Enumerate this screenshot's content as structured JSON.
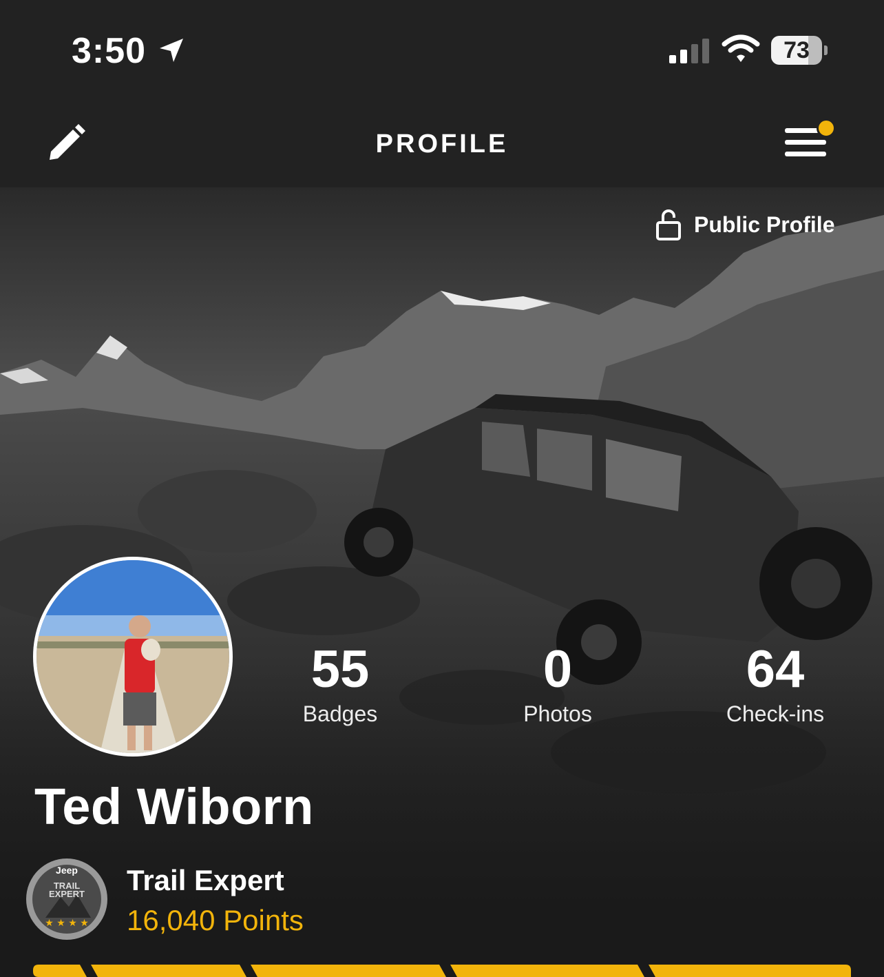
{
  "status_bar": {
    "time": "3:50",
    "battery_percent": "73",
    "battery_level": 0.73,
    "icons": [
      "location-arrow-icon",
      "cellular-signal-icon",
      "wifi-icon",
      "battery-icon"
    ]
  },
  "header": {
    "title": "PROFILE",
    "edit_icon": "pencil-icon",
    "menu_icon": "hamburger-menu-icon",
    "notification_dot_color": "#f2b40b"
  },
  "profile": {
    "visibility_label": "Public Profile",
    "visibility_icon": "unlocked-padlock-icon",
    "name": "Ted Wiborn",
    "stats": [
      {
        "value": "55",
        "label": "Badges"
      },
      {
        "value": "0",
        "label": "Photos"
      },
      {
        "value": "64",
        "label": "Check-ins"
      }
    ],
    "rank": {
      "title": "Trail Expert",
      "points": "16,040 Points",
      "badge_text": [
        "Jeep",
        "TRAIL",
        "EXPERT"
      ]
    }
  },
  "colors": {
    "accent": "#f2b40b",
    "header_bg": "#222222",
    "text": "#ffffff"
  }
}
